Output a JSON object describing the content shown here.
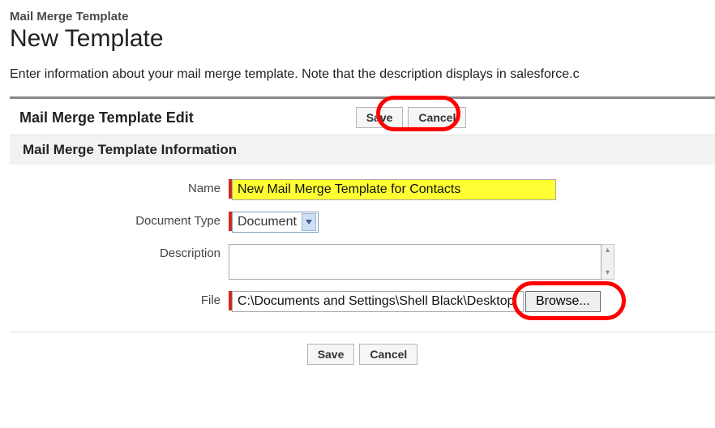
{
  "breadcrumb": "Mail Merge Template",
  "page_title": "New Template",
  "intro": "Enter information about your mail merge template. Note that the description displays in salesforce.c",
  "header": {
    "title": "Mail Merge Template Edit",
    "save_label": "Save",
    "cancel_label": "Cancel"
  },
  "subsection_title": "Mail Merge Template Information",
  "fields": {
    "name": {
      "label": "Name",
      "value": "New Mail Merge Template for Contacts"
    },
    "doc_type": {
      "label": "Document Type",
      "selected": "Document"
    },
    "description": {
      "label": "Description",
      "value": ""
    },
    "file": {
      "label": "File",
      "value": "C:\\Documents and Settings\\Shell Black\\Desktop",
      "browse_label": "Browse..."
    }
  },
  "footer": {
    "save_label": "Save",
    "cancel_label": "Cancel"
  }
}
